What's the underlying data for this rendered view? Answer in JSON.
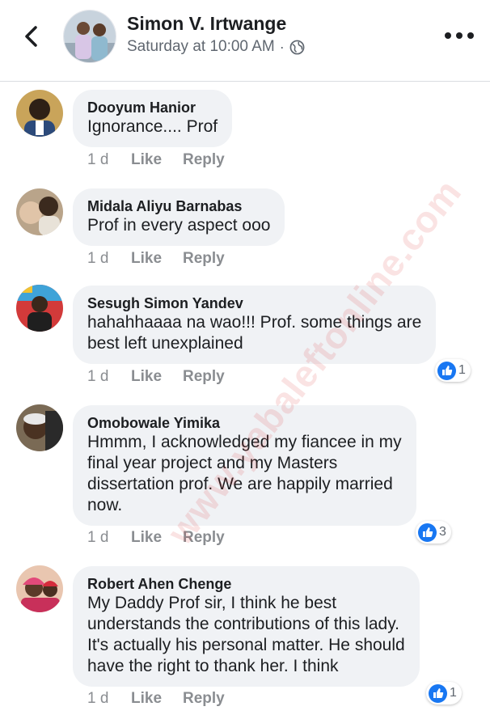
{
  "header": {
    "author": "Simon V. Irtwange",
    "timestamp": "Saturday at 10:00 AM",
    "separator": "·",
    "privacy_icon": "globe-icon",
    "back_icon": "chevron-left-icon",
    "more_icon": "more-horizontal-icon"
  },
  "colors": {
    "accent": "#1877f2",
    "bubble_bg": "#f0f2f5",
    "meta_text": "#8a8d91"
  },
  "comments": [
    {
      "name": "Dooyum Hanior",
      "text": "Ignorance.... Prof",
      "time": "1 d",
      "like": "Like",
      "reply": "Reply",
      "reactions": ""
    },
    {
      "name": "Midala Aliyu Barnabas",
      "text": "Prof in every aspect ooo",
      "time": "1 d",
      "like": "Like",
      "reply": "Reply",
      "reactions": ""
    },
    {
      "name": "Sesugh Simon Yandev",
      "text": "hahahhaaaa na wao!!! Prof. some things are\nbest left unexplained",
      "time": "1 d",
      "like": "Like",
      "reply": "Reply",
      "reactions": "1"
    },
    {
      "name": "Omobowale Yimika",
      "text": "Hmmm, I acknowledged my fiancee in my\nfinal year project and my Masters\ndissertation prof. We are happily married\nnow.",
      "time": "1 d",
      "like": "Like",
      "reply": "Reply",
      "reactions": "3"
    },
    {
      "name": "Robert Ahen Chenge",
      "text": "My Daddy Prof sir, I think he best\nunderstands the contributions of this lady.\nIt's actually his personal matter. He should\nhave the right to thank her. I think",
      "time": "1 d",
      "like": "Like",
      "reply": "Reply",
      "reactions": "1"
    }
  ],
  "watermark": "www.yabaleftonline.com"
}
